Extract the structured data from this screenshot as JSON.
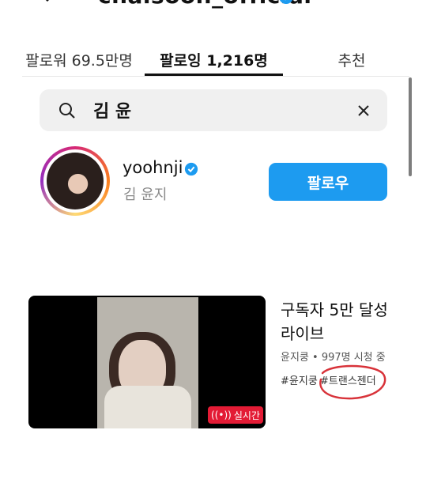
{
  "header": {
    "title": "chaisoon_official",
    "back_icon": "back-arrow-icon",
    "verified_icon": "verified-badge-icon"
  },
  "tabs": [
    {
      "label": "팔로워 69.5만명",
      "active": false
    },
    {
      "label": "팔로잉 1,216명",
      "active": true
    },
    {
      "label": "추천",
      "active": false
    }
  ],
  "search": {
    "value": "김 윤",
    "search_icon": "search-icon",
    "clear_icon": "close-icon"
  },
  "result": {
    "username": "yoohnji",
    "full_name": "김 윤지",
    "follow_label": "팔로우",
    "verified": true
  },
  "live": {
    "title": "구독자 5만 달성 라이브",
    "meta": "윤지쿵 • 997명 시청 중",
    "tag1": "#윤지쿵",
    "tag2": "#트랜스젠더",
    "badge": "실시간",
    "badge_color": "#e31b35"
  },
  "colors": {
    "accent": "#1d9bf0",
    "annotation": "#d8333a"
  }
}
